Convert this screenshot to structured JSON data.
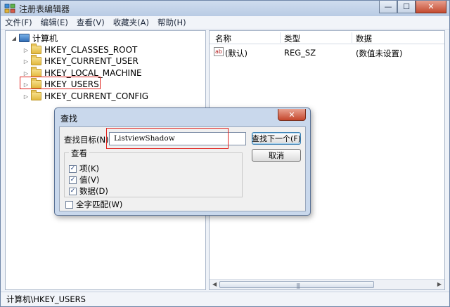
{
  "window": {
    "title": "注册表编辑器"
  },
  "menu": [
    "文件(F)",
    "编辑(E)",
    "查看(V)",
    "收藏夹(A)",
    "帮助(H)"
  ],
  "tree": {
    "root": "计算机",
    "items": [
      "HKEY_CLASSES_ROOT",
      "HKEY_CURRENT_USER",
      "HKEY_LOCAL_MACHINE",
      "HKEY_USERS",
      "HKEY_CURRENT_CONFIG"
    ]
  },
  "list": {
    "headers": {
      "name": "名称",
      "type": "类型",
      "data": "数据"
    },
    "rows": [
      {
        "name": "(默认)",
        "type": "REG_SZ",
        "data": "(数值未设置)"
      }
    ]
  },
  "status": {
    "path": "计算机\\HKEY_USERS"
  },
  "dialog": {
    "title": "查找",
    "find_label": "查找目标(N):",
    "find_value": "ListviewShadow",
    "find_next": "查找下一个(F)",
    "cancel": "取消",
    "look_at": "查看",
    "options": [
      {
        "label": "项(K)",
        "checked": true
      },
      {
        "label": "值(V)",
        "checked": true
      },
      {
        "label": "数据(D)",
        "checked": true
      }
    ],
    "whole_word": {
      "label": "全字匹配(W)",
      "checked": false
    }
  },
  "icons": {
    "checked": "✓",
    "close": "✕",
    "minimize": "—",
    "maximize": "☐"
  },
  "colors": {
    "highlight": "#e0221e",
    "titlebar": "#c4d3ea"
  }
}
